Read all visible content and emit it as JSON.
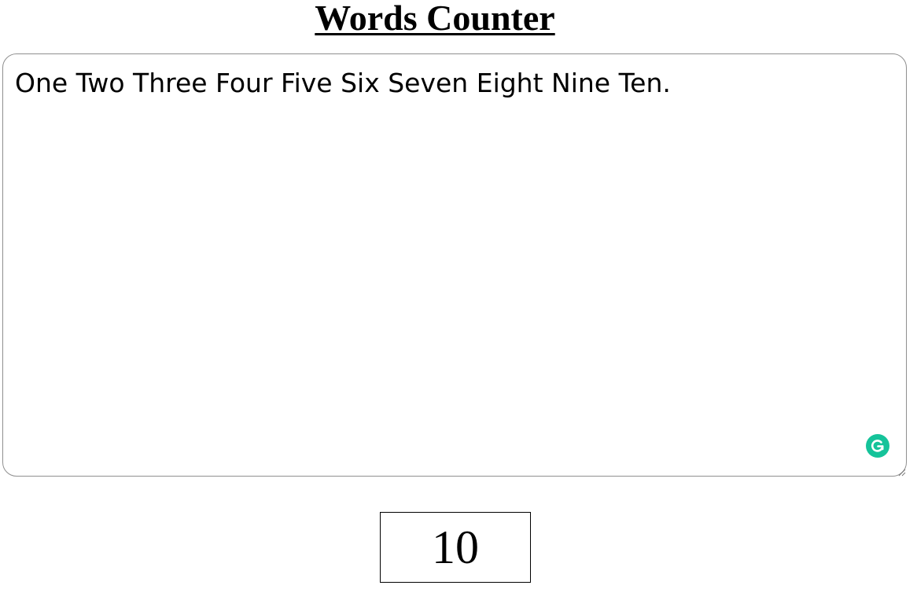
{
  "header": {
    "title": "Words Counter"
  },
  "editor": {
    "value": "One Two Three Four Five Six Seven Eight Nine Ten.",
    "badge_icon": "grammarly-icon",
    "badge_color": "#15c39a",
    "resize_icon": "resize-handle-icon"
  },
  "counter": {
    "value": "10"
  }
}
